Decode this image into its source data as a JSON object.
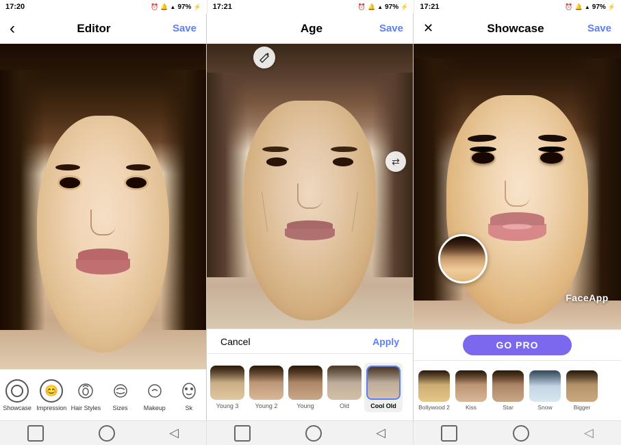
{
  "statusBars": [
    {
      "time": "17:20",
      "icons": [
        "📷",
        "🔔",
        "📶",
        "🔋"
      ],
      "battery": "97%"
    },
    {
      "time": "17:21",
      "icons": [
        "📷",
        "🔔",
        "📶",
        "🔋"
      ],
      "battery": "97%"
    },
    {
      "time": "17:21",
      "icons": [
        "📷",
        "🔔",
        "📶",
        "🔋"
      ],
      "battery": "97%"
    }
  ],
  "panel1": {
    "title": "Editor",
    "saveLabel": "Save",
    "backIcon": "‹",
    "navItems": [
      {
        "icon": "☺",
        "label": "Showcase"
      },
      {
        "icon": "😊",
        "label": "Impression"
      },
      {
        "icon": "💇",
        "label": "Hair Styles"
      },
      {
        "icon": "↔",
        "label": "Sizes"
      },
      {
        "icon": "💄",
        "label": "Makeup"
      },
      {
        "icon": "✂",
        "label": "Sk"
      }
    ]
  },
  "panel2": {
    "title": "Age",
    "saveLabel": "Save",
    "cancelLabel": "Cancel",
    "applyLabel": "Apply",
    "filters": [
      {
        "id": "young3",
        "label": "Young 3",
        "active": false
      },
      {
        "id": "young2",
        "label": "Young 2",
        "active": false
      },
      {
        "id": "young",
        "label": "Young",
        "active": false
      },
      {
        "id": "old",
        "label": "Old",
        "active": false
      },
      {
        "id": "coolold",
        "label": "Cool Old",
        "active": true
      }
    ]
  },
  "panel3": {
    "title": "Showcase",
    "saveLabel": "Save",
    "closeIcon": "✕",
    "faceappLabel": "FaceApp",
    "goProLabel": "GO PRO",
    "filters": [
      {
        "id": "bollywood2",
        "label": "Bollywood 2",
        "active": false
      },
      {
        "id": "kiss",
        "label": "Kiss",
        "active": false
      },
      {
        "id": "star",
        "label": "Star",
        "active": false
      },
      {
        "id": "snow",
        "label": "Snow",
        "active": false
      },
      {
        "id": "bigger",
        "label": "Bigger",
        "active": false
      }
    ]
  },
  "bottomNav": {
    "items": [
      {
        "icon": "□",
        "label": "square"
      },
      {
        "icon": "○",
        "label": "circle"
      },
      {
        "icon": "◁",
        "label": "back"
      },
      {
        "icon": "□",
        "label": "square"
      },
      {
        "icon": "○",
        "label": "circle"
      },
      {
        "icon": "◁",
        "label": "back"
      },
      {
        "icon": "□",
        "label": "square"
      },
      {
        "icon": "○",
        "label": "circle"
      },
      {
        "icon": "◁",
        "label": "back"
      }
    ]
  }
}
